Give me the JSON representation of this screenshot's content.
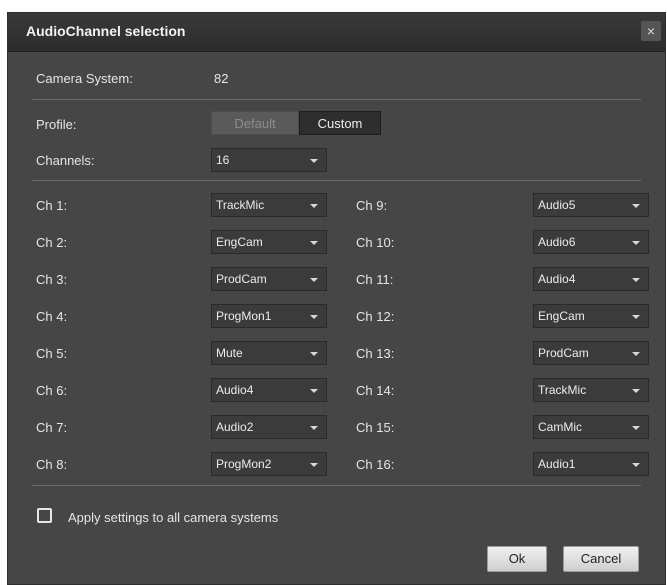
{
  "dialog": {
    "title": "AudioChannel selection",
    "close_glyph": "×"
  },
  "camera_system": {
    "label": "Camera System:",
    "value": "82"
  },
  "profile": {
    "label": "Profile:",
    "options": [
      "Default",
      "Custom"
    ],
    "selected": "Custom"
  },
  "channels": {
    "label": "Channels:",
    "value": "16"
  },
  "left_channels": [
    {
      "label": "Ch 1:",
      "value": "TrackMic"
    },
    {
      "label": "Ch 2:",
      "value": "EngCam"
    },
    {
      "label": "Ch 3:",
      "value": "ProdCam"
    },
    {
      "label": "Ch 4:",
      "value": "ProgMon1"
    },
    {
      "label": "Ch 5:",
      "value": "Mute"
    },
    {
      "label": "Ch 6:",
      "value": "Audio4"
    },
    {
      "label": "Ch 7:",
      "value": "Audio2"
    },
    {
      "label": "Ch 8:",
      "value": "ProgMon2"
    }
  ],
  "right_channels": [
    {
      "label": "Ch 9:",
      "value": "Audio5"
    },
    {
      "label": "Ch 10:",
      "value": "Audio6"
    },
    {
      "label": "Ch 11:",
      "value": "Audio4"
    },
    {
      "label": "Ch 12:",
      "value": "EngCam"
    },
    {
      "label": "Ch 13:",
      "value": "ProdCam"
    },
    {
      "label": "Ch 14:",
      "value": "TrackMic"
    },
    {
      "label": "Ch 15:",
      "value": "CamMic"
    },
    {
      "label": "Ch 16:",
      "value": "Audio1"
    }
  ],
  "apply_all": {
    "label": "Apply settings to all camera systems",
    "checked": false
  },
  "buttons": {
    "ok": "Ok",
    "cancel": "Cancel"
  },
  "icons": {
    "close": "close-icon",
    "dropdown": "chevron-down-icon",
    "checkbox": "checkbox-unchecked-icon"
  }
}
